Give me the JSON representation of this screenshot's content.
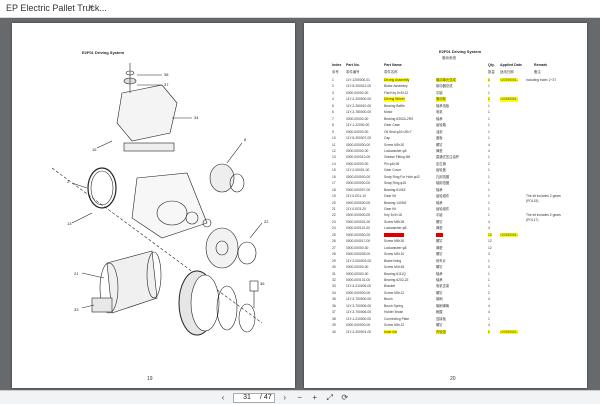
{
  "tab": {
    "title": "EP Electric Pallet Truck...",
    "close": "×"
  },
  "left_page": {
    "title": "E2F01 Driving System",
    "number": "19"
  },
  "right_page": {
    "title": "E2F01 Driving System",
    "subtitle": "驱动系统",
    "number": "20",
    "headers": {
      "index": "Index",
      "part_no": "Part No.",
      "part_name": "Part Name",
      "qty": "Qty.",
      "date": "Applied Date",
      "remark": "Remark"
    },
    "headers_cn": {
      "index": "序号",
      "part_no": "零件编号",
      "part_name": "零件名称",
      "cn": "",
      "qty": "数量",
      "date": "适用日期",
      "remark": "备注"
    },
    "rows": [
      {
        "idx": "1",
        "pn": "11Y-1200000-01",
        "name": "Driving Assembly",
        "cn": "驱动单元总成",
        "qty": "1",
        "date": "<20190001-",
        "hl": "y",
        "remark": "including index 2~37"
      },
      {
        "idx": "2",
        "pn": "11Y-5-200012-00",
        "name": "Brake Assembly",
        "cn": "制动器总成",
        "qty": "1",
        "date": "",
        "hl": "",
        "remark": ""
      },
      {
        "idx": "3",
        "pn": "0000-00000-00",
        "name": "Flat Key 5×5×12",
        "cn": "平键",
        "qty": "1",
        "date": "",
        "hl": "",
        "remark": ""
      },
      {
        "idx": "4",
        "pn": "11Y-2-200000-00",
        "name": "Driving Wheel",
        "cn": "驱动轮",
        "qty": "1",
        "date": "<20190001-",
        "hl": "y",
        "remark": ""
      },
      {
        "idx": "5",
        "pn": "11Y-2-260010-00",
        "name": "Bearing Baffle",
        "cn": "轴承挡板",
        "qty": "1",
        "date": "",
        "hl": "",
        "remark": ""
      },
      {
        "idx": "6",
        "pn": "11Y-3-780000-00",
        "name": "Motor",
        "cn": "电机",
        "qty": "1",
        "date": "",
        "hl": "",
        "remark": ""
      },
      {
        "idx": "7",
        "pn": "0000-00000-00",
        "name": "Bearing 6302A-2RS",
        "cn": "轴承",
        "qty": "1",
        "date": "",
        "hl": "",
        "remark": ""
      },
      {
        "idx": "8",
        "pn": "11Y-1-22000-00",
        "name": "Gear Case",
        "cn": "齿轮箱",
        "qty": "1",
        "date": "",
        "hl": "",
        "remark": ""
      },
      {
        "idx": "9",
        "pn": "0000-00000-00",
        "name": "Oil Seal φ10×28×7",
        "cn": "油封",
        "qty": "1",
        "date": "",
        "hl": "",
        "remark": ""
      },
      {
        "idx": "10",
        "pn": "11Y-5-200007-00",
        "name": "Cap",
        "cn": "盖板",
        "qty": "1",
        "date": "",
        "hl": "",
        "remark": ""
      },
      {
        "idx": "11",
        "pn": "0000-000000-00",
        "name": "Screw M5×20",
        "cn": "螺钉",
        "qty": "4",
        "date": "",
        "hl": "",
        "remark": ""
      },
      {
        "idx": "12",
        "pn": "0000-00000-00",
        "name": "Lockwasher φ5",
        "cn": "弹垫",
        "qty": "4",
        "date": "",
        "hl": "",
        "remark": ""
      },
      {
        "idx": "13",
        "pn": "0000-000010-00",
        "name": "Grease Fitting M6",
        "cn": "直通式压注油杯",
        "qty": "1",
        "date": "",
        "hl": "",
        "remark": ""
      },
      {
        "idx": "14",
        "pn": "0000-00000-00",
        "name": "Pin φ6×28",
        "cn": "定位销",
        "qty": "2",
        "date": "",
        "hl": "",
        "remark": ""
      },
      {
        "idx": "15",
        "pn": "11Y-2-00001-00",
        "name": "Gear Cover",
        "cn": "齿轮盖",
        "qty": "1",
        "date": "",
        "hl": "",
        "remark": ""
      },
      {
        "idx": "16",
        "pn": "0000-000000-00",
        "name": "Snap Ring For Hole φ42",
        "cn": "孔用挡圈",
        "qty": "1",
        "date": "",
        "hl": "",
        "remark": ""
      },
      {
        "idx": "17",
        "pn": "0000-000000-00",
        "name": "Snap Ring φ15",
        "cn": "轴用挡圈",
        "qty": "1",
        "date": "",
        "hl": "",
        "remark": ""
      },
      {
        "idx": "18",
        "pn": "0000-000007-00",
        "name": "Bearing 6106Z",
        "cn": "轴承",
        "qty": "1",
        "date": "",
        "hl": "",
        "remark": ""
      },
      {
        "idx": "19",
        "pn": "11Y-0-E01-10",
        "name": "Gear Kit",
        "cn": "齿轮组件",
        "qty": "1",
        "date": "",
        "hl": "",
        "remark": ""
      },
      {
        "idx": "20",
        "pn": "0000-000000-00",
        "name": "Bearing 1409IZ",
        "cn": "轴承",
        "qty": "1",
        "date": "",
        "hl": "",
        "remark": ""
      },
      {
        "idx": "21",
        "pn": "11Y-0-E03-20",
        "name": "Gear Kit",
        "cn": "齿轮组件",
        "qty": "1",
        "date": "",
        "hl": "",
        "remark": ""
      },
      {
        "idx": "22",
        "pn": "0000-000000-00",
        "name": "Key 5×5×18",
        "cn": "平键",
        "qty": "1",
        "date": "",
        "hl": "",
        "remark": ""
      },
      {
        "idx": "23",
        "pn": "0000-000001-00",
        "name": "Screw M8×35",
        "cn": "螺钉",
        "qty": "4",
        "date": "",
        "hl": "",
        "remark": ""
      },
      {
        "idx": "24",
        "pn": "0000-000110-00",
        "name": "Lockwasher φ8",
        "cn": "弹垫",
        "qty": "4",
        "date": "",
        "hl": "",
        "remark": ""
      },
      {
        "idx": "25",
        "pn": "0000-000000-00",
        "name": "Screw M8×20",
        "cn": "螺钉",
        "qty": "12",
        "date": "<20190001-",
        "hl": "r",
        "remark": ""
      },
      {
        "idx": "26",
        "pn": "0000-000017-00",
        "name": "Screw M8×30",
        "cn": "螺钉",
        "qty": "12",
        "date": "",
        "hl": "",
        "remark": ""
      },
      {
        "idx": "27",
        "pn": "0000-00000-00",
        "name": "Lockwasher φ8",
        "cn": "弹垫",
        "qty": "12",
        "date": "",
        "hl": "",
        "remark": ""
      },
      {
        "idx": "28",
        "pn": "0000-000005-00",
        "name": "Screw M5×10",
        "cn": "螺钉",
        "qty": "3",
        "date": "",
        "hl": "",
        "remark": ""
      },
      {
        "idx": "29",
        "pn": "11Y-2-000003-00",
        "name": "Brake lining",
        "cn": "刹车片",
        "qty": "1",
        "date": "",
        "hl": "",
        "remark": ""
      },
      {
        "idx": "30",
        "pn": "0000-00000-00",
        "name": "Screw M4×45",
        "cn": "螺钉",
        "qty": "3",
        "date": "",
        "hl": "",
        "remark": ""
      },
      {
        "idx": "31",
        "pn": "0000-00000-00",
        "name": "Bearing 6111Q",
        "cn": "轴承",
        "qty": "1",
        "date": "",
        "hl": "",
        "remark": ""
      },
      {
        "idx": "32",
        "pn": "0000-000131-00",
        "name": "Bearing 6202-2Z",
        "cn": "轴承",
        "qty": "1",
        "date": "",
        "hl": "",
        "remark": ""
      },
      {
        "idx": "33",
        "pn": "11Y-3-210006-00",
        "name": "Bracket",
        "cn": "电机支架",
        "qty": "1",
        "date": "",
        "hl": "",
        "remark": ""
      },
      {
        "idx": "34",
        "pn": "0000-000000-00",
        "name": "Screw M5×12",
        "cn": "螺钉",
        "qty": "2",
        "date": "",
        "hl": "",
        "remark": ""
      },
      {
        "idx": "35",
        "pn": "11Y-3-700000-00",
        "name": "Brush",
        "cn": "碳刷",
        "qty": "4",
        "date": "",
        "hl": "",
        "remark": ""
      },
      {
        "idx": "36",
        "pn": "11Y-3-700006-00",
        "name": "Brush Spring",
        "cn": "碳刷弹簧",
        "qty": "4",
        "date": "",
        "hl": "",
        "remark": ""
      },
      {
        "idx": "37",
        "pn": "11Y-3-700006-00",
        "name": "Holder Brush",
        "cn": "刷握",
        "qty": "4",
        "date": "",
        "hl": "",
        "remark": ""
      },
      {
        "idx": "38",
        "pn": "11Y-1-210000-00",
        "name": "Connecting Plate",
        "cn": "连接板",
        "qty": "1",
        "date": "",
        "hl": "",
        "remark": ""
      },
      {
        "idx": "39",
        "pn": "0000-000000-00",
        "name": "Screw M6×12",
        "cn": "螺钉",
        "qty": "4",
        "date": "",
        "hl": "",
        "remark": ""
      },
      {
        "idx": "40",
        "pn": "11Y-3-200001-00",
        "name": "Inner rim",
        "cn": "内轮毂",
        "qty": "1",
        "date": "<20190001-",
        "hl": "y",
        "remark": ""
      }
    ],
    "notes": [
      {
        "text": "The kit includes 2 gears"
      },
      {
        "text": "(POL15)"
      },
      {
        "text": "The kit includes 2 gears"
      },
      {
        "text": "(POL17)"
      }
    ]
  },
  "toolbar": {
    "current_page": "31",
    "total_pages": "/ 47",
    "prev_icon": "chevron-left-icon",
    "next_icon": "chevron-right-icon"
  }
}
